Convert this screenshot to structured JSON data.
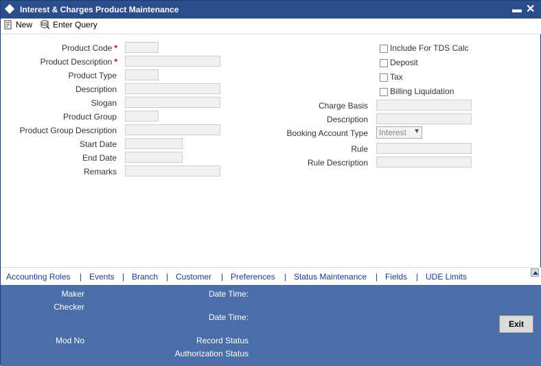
{
  "window": {
    "title": "Interest & Charges Product Maintenance",
    "minimize_glyph": "▬",
    "close_glyph": "✕"
  },
  "toolbar": {
    "new_label": "New",
    "enter_query_label": "Enter Query"
  },
  "left_fields": [
    {
      "label": "Product Code",
      "required": true
    },
    {
      "label": "Product Description",
      "required": true
    },
    {
      "label": "Product Type",
      "required": false
    },
    {
      "label": "Description",
      "required": false
    },
    {
      "label": "Slogan",
      "required": false
    },
    {
      "label": "Product Group",
      "required": false
    },
    {
      "label": "Product Group Description",
      "required": false
    },
    {
      "label": "Start Date",
      "required": false
    },
    {
      "label": "End Date",
      "required": false
    },
    {
      "label": "Remarks",
      "required": false
    }
  ],
  "required_marker": "*",
  "checkboxes": [
    {
      "label": "Include For TDS Calc"
    },
    {
      "label": "Deposit"
    },
    {
      "label": "Tax"
    },
    {
      "label": "Billing Liquidation"
    }
  ],
  "right_fields": [
    {
      "label": "Charge Basis"
    },
    {
      "label": "Description"
    },
    {
      "label": "Booking Account Type",
      "value": "Interest"
    },
    {
      "label": "Rule"
    },
    {
      "label": "Rule Description"
    }
  ],
  "tabs": [
    "Accounting Roles",
    "Events",
    "Branch",
    "Customer",
    "Preferences",
    "Status Maintenance",
    "Fields",
    "UDE Limits"
  ],
  "tab_separator": "|",
  "footer": {
    "maker": "Maker",
    "checker": "Checker",
    "mod_no": "Mod No",
    "date_time_1": "Date Time:",
    "date_time_2": "Date Time:",
    "record_status": "Record Status",
    "authorization_status": "Authorization Status",
    "exit_label": "Exit"
  }
}
